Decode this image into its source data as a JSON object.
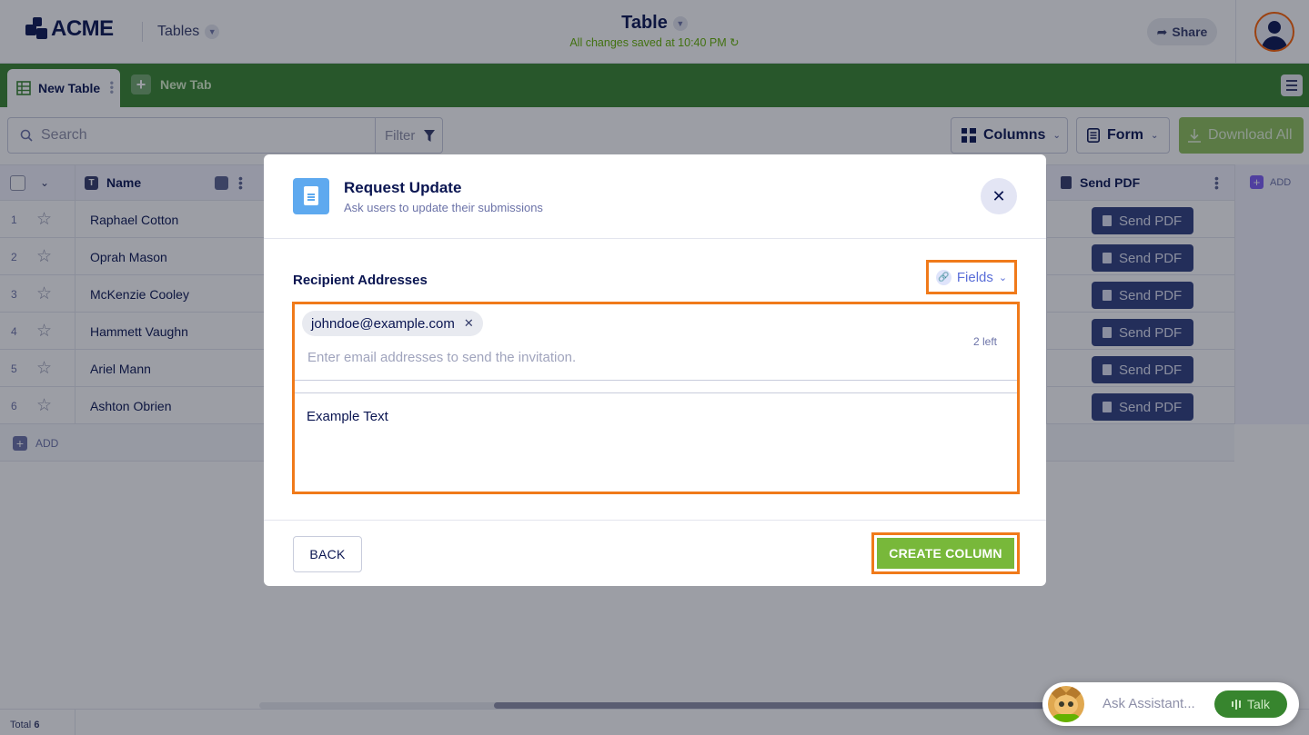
{
  "header": {
    "logo_text": "ACME",
    "tables_label": "Tables",
    "doc_title": "Table",
    "saved_status": "All changes saved at 10:40 PM",
    "share_label": "Share"
  },
  "tabs": {
    "active_label": "New Table",
    "new_tab_label": "New Tab"
  },
  "toolbar": {
    "search_placeholder": "Search",
    "filter_label": "Filter",
    "columns_label": "Columns",
    "form_label": "Form",
    "download_label": "Download All"
  },
  "table": {
    "header": {
      "name": "Name",
      "send_pdf": "Send PDF",
      "add": "ADD"
    },
    "rows": [
      {
        "num": "1",
        "name": "Raphael Cotton",
        "action": "Send PDF"
      },
      {
        "num": "2",
        "name": "Oprah Mason",
        "action": "Send PDF"
      },
      {
        "num": "3",
        "name": "McKenzie Cooley",
        "action": "Send PDF"
      },
      {
        "num": "4",
        "name": "Hammett Vaughn",
        "action": "Send PDF"
      },
      {
        "num": "5",
        "name": "Ariel Mann",
        "action": "Send PDF"
      },
      {
        "num": "6",
        "name": "Ashton Obrien",
        "action": "Send PDF"
      }
    ],
    "add_row": "ADD"
  },
  "footer": {
    "total_label": "Total",
    "total_count": "6"
  },
  "assistant": {
    "placeholder": "Ask Assistant...",
    "talk_label": "Talk"
  },
  "modal": {
    "title": "Request Update",
    "subtitle": "Ask users to update their submissions",
    "recipient_label": "Recipient Addresses",
    "fields_label": "Fields",
    "chip_email": "johndoe@example.com",
    "email_placeholder": "Enter email addresses to send the invitation.",
    "remaining": "2 left",
    "message_text": "Example Text",
    "back_label": "BACK",
    "create_label": "CREATE COLUMN"
  },
  "colors": {
    "brand_green": "#37852e",
    "accent_orange": "#f07a1a",
    "navy": "#0a1551",
    "send_pdf_button": "#2f3f7f",
    "create_button": "#78b83a"
  },
  "icons": [
    "acme-logo-icon",
    "chevron-down-icon",
    "share-icon",
    "avatar-icon",
    "grid-icon",
    "plus-icon",
    "hamburger-menu-icon",
    "search-icon",
    "filter-funnel-icon",
    "columns-icon",
    "form-icon",
    "download-icon",
    "star-icon",
    "text-type-icon",
    "lock-icon",
    "pdf-icon",
    "document-icon",
    "close-icon",
    "link-icon",
    "remove-chip-icon",
    "assistant-avatar-icon",
    "audio-bars-icon"
  ]
}
